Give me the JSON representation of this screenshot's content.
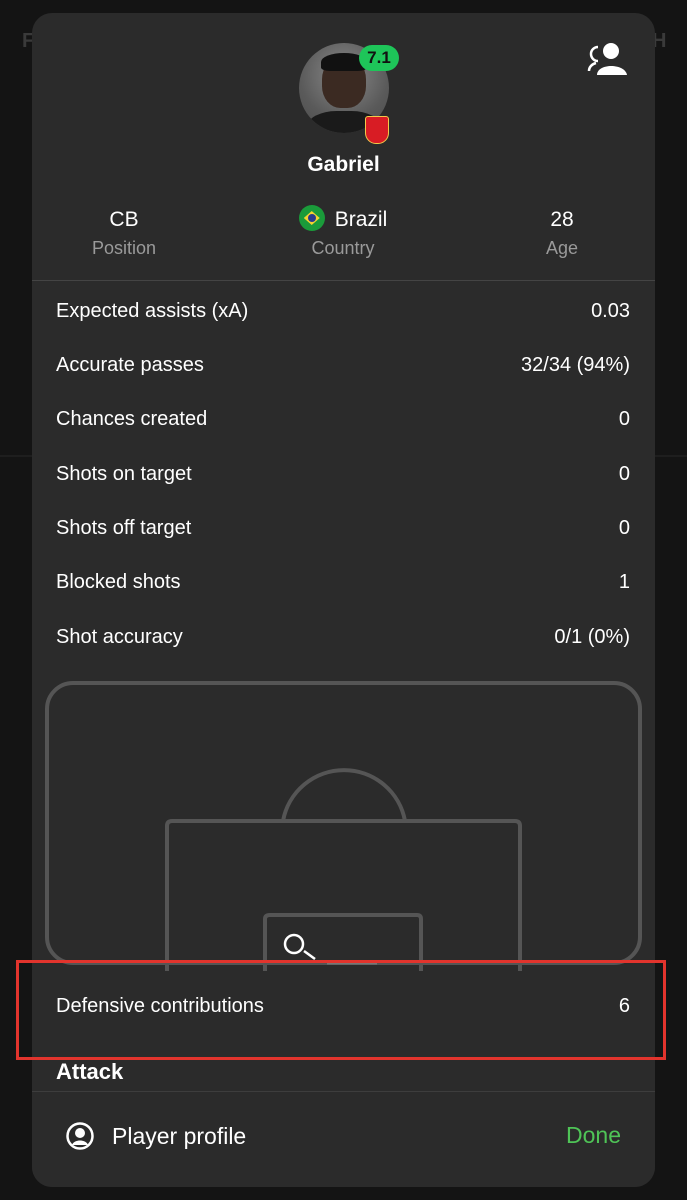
{
  "background": {
    "left_letter": "F",
    "right_letter": "H"
  },
  "player": {
    "rating": "7.1",
    "name": "Gabriel",
    "club_badge": "arsenal-badge",
    "profile_icon": "user-switch-icon"
  },
  "info": [
    {
      "value": "CB",
      "label": "Position"
    },
    {
      "value": "Brazil",
      "label": "Country",
      "flag": "brazil-flag"
    },
    {
      "value": "28",
      "label": "Age"
    }
  ],
  "stats": [
    {
      "label": "Expected assists (xA)",
      "value": "0.03"
    },
    {
      "label": "Accurate passes",
      "value": "32/34 (94%)"
    },
    {
      "label": "Chances created",
      "value": "0"
    },
    {
      "label": "Shots on target",
      "value": "0"
    },
    {
      "label": "Shots off target",
      "value": "0"
    },
    {
      "label": "Blocked shots",
      "value": "1"
    },
    {
      "label": "Shot accuracy",
      "value": "0/1 (0%)"
    }
  ],
  "defensive": {
    "label": "Defensive contributions",
    "value": "6"
  },
  "section": {
    "title": "Attack"
  },
  "footer": {
    "profile_label": "Player profile",
    "done_label": "Done"
  },
  "colors": {
    "sheet": "#2b2b2b",
    "rating_badge": "#1ec559",
    "done": "#4fc457",
    "highlight": "#e2342d"
  }
}
